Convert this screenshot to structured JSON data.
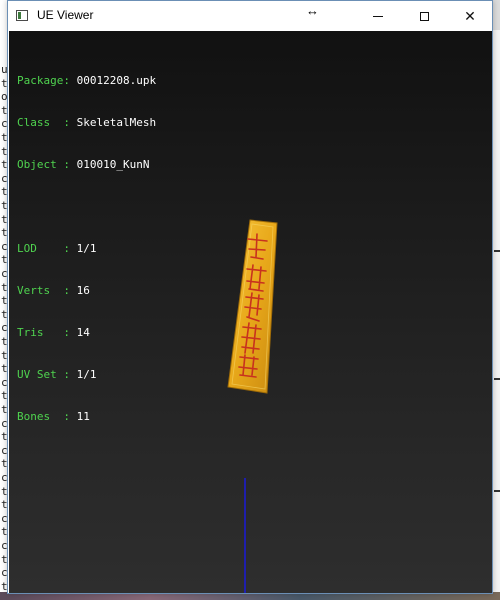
{
  "window": {
    "title": "UE Viewer",
    "minimize_icon": "minimize-icon",
    "maximize_icon": "maximize-icon",
    "close_icon": "close-icon",
    "close_glyph": "✕",
    "cursor_glyph": "↔"
  },
  "info": {
    "package": {
      "key": "Package",
      "sep": ": ",
      "value": "00012208.upk"
    },
    "class": {
      "key": "Class  ",
      "sep": ": ",
      "value": "SkeletalMesh"
    },
    "object": {
      "key": "Object ",
      "sep": ": ",
      "value": "010010_KunN"
    },
    "lod": {
      "key": "LOD    ",
      "sep": ": ",
      "value": "1/1"
    },
    "verts": {
      "key": "Verts  ",
      "sep": ": ",
      "value": "16"
    },
    "tris": {
      "key": "Tris   ",
      "sep": ": ",
      "value": "14"
    },
    "uvset": {
      "key": "UV Set ",
      "sep": ": ",
      "value": "1/1"
    },
    "bones": {
      "key": "Bones  ",
      "sep": ": ",
      "value": "11"
    }
  },
  "colors": {
    "label": "#4fd34f",
    "value": "#ffffff",
    "talisman_fill": "#e8a81a",
    "talisman_glyph": "#c8321e",
    "axis_line": "#1a1ad8"
  },
  "background": {
    "left_strip_chars": [
      "u",
      "t",
      "o",
      "t",
      "c",
      "t",
      "t",
      "t",
      "c",
      "t",
      "t",
      "t",
      "t",
      "c",
      "t",
      "c",
      "t",
      "t",
      "t",
      "c",
      "t",
      "t",
      "t",
      "c",
      "t",
      "t",
      "c",
      "t",
      "c",
      "t",
      "c",
      "t",
      "t",
      "c",
      "t",
      "c",
      "t",
      "c",
      "t"
    ]
  }
}
